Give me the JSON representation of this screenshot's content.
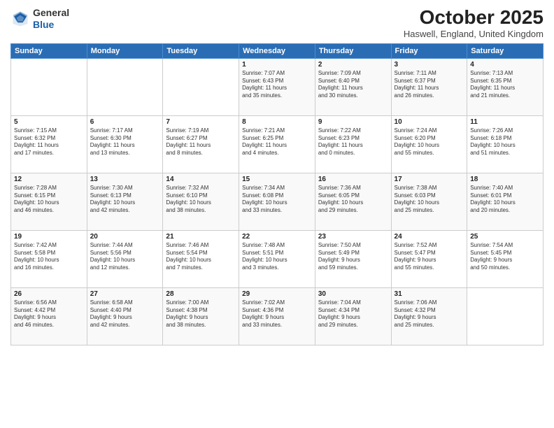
{
  "logo": {
    "general": "General",
    "blue": "Blue"
  },
  "title": "October 2025",
  "location": "Haswell, England, United Kingdom",
  "days_of_week": [
    "Sunday",
    "Monday",
    "Tuesday",
    "Wednesday",
    "Thursday",
    "Friday",
    "Saturday"
  ],
  "weeks": [
    [
      {
        "day": "",
        "info": ""
      },
      {
        "day": "",
        "info": ""
      },
      {
        "day": "",
        "info": ""
      },
      {
        "day": "1",
        "info": "Sunrise: 7:07 AM\nSunset: 6:43 PM\nDaylight: 11 hours\nand 35 minutes."
      },
      {
        "day": "2",
        "info": "Sunrise: 7:09 AM\nSunset: 6:40 PM\nDaylight: 11 hours\nand 30 minutes."
      },
      {
        "day": "3",
        "info": "Sunrise: 7:11 AM\nSunset: 6:37 PM\nDaylight: 11 hours\nand 26 minutes."
      },
      {
        "day": "4",
        "info": "Sunrise: 7:13 AM\nSunset: 6:35 PM\nDaylight: 11 hours\nand 21 minutes."
      }
    ],
    [
      {
        "day": "5",
        "info": "Sunrise: 7:15 AM\nSunset: 6:32 PM\nDaylight: 11 hours\nand 17 minutes."
      },
      {
        "day": "6",
        "info": "Sunrise: 7:17 AM\nSunset: 6:30 PM\nDaylight: 11 hours\nand 13 minutes."
      },
      {
        "day": "7",
        "info": "Sunrise: 7:19 AM\nSunset: 6:27 PM\nDaylight: 11 hours\nand 8 minutes."
      },
      {
        "day": "8",
        "info": "Sunrise: 7:21 AM\nSunset: 6:25 PM\nDaylight: 11 hours\nand 4 minutes."
      },
      {
        "day": "9",
        "info": "Sunrise: 7:22 AM\nSunset: 6:23 PM\nDaylight: 11 hours\nand 0 minutes."
      },
      {
        "day": "10",
        "info": "Sunrise: 7:24 AM\nSunset: 6:20 PM\nDaylight: 10 hours\nand 55 minutes."
      },
      {
        "day": "11",
        "info": "Sunrise: 7:26 AM\nSunset: 6:18 PM\nDaylight: 10 hours\nand 51 minutes."
      }
    ],
    [
      {
        "day": "12",
        "info": "Sunrise: 7:28 AM\nSunset: 6:15 PM\nDaylight: 10 hours\nand 46 minutes."
      },
      {
        "day": "13",
        "info": "Sunrise: 7:30 AM\nSunset: 6:13 PM\nDaylight: 10 hours\nand 42 minutes."
      },
      {
        "day": "14",
        "info": "Sunrise: 7:32 AM\nSunset: 6:10 PM\nDaylight: 10 hours\nand 38 minutes."
      },
      {
        "day": "15",
        "info": "Sunrise: 7:34 AM\nSunset: 6:08 PM\nDaylight: 10 hours\nand 33 minutes."
      },
      {
        "day": "16",
        "info": "Sunrise: 7:36 AM\nSunset: 6:05 PM\nDaylight: 10 hours\nand 29 minutes."
      },
      {
        "day": "17",
        "info": "Sunrise: 7:38 AM\nSunset: 6:03 PM\nDaylight: 10 hours\nand 25 minutes."
      },
      {
        "day": "18",
        "info": "Sunrise: 7:40 AM\nSunset: 6:01 PM\nDaylight: 10 hours\nand 20 minutes."
      }
    ],
    [
      {
        "day": "19",
        "info": "Sunrise: 7:42 AM\nSunset: 5:58 PM\nDaylight: 10 hours\nand 16 minutes."
      },
      {
        "day": "20",
        "info": "Sunrise: 7:44 AM\nSunset: 5:56 PM\nDaylight: 10 hours\nand 12 minutes."
      },
      {
        "day": "21",
        "info": "Sunrise: 7:46 AM\nSunset: 5:54 PM\nDaylight: 10 hours\nand 7 minutes."
      },
      {
        "day": "22",
        "info": "Sunrise: 7:48 AM\nSunset: 5:51 PM\nDaylight: 10 hours\nand 3 minutes."
      },
      {
        "day": "23",
        "info": "Sunrise: 7:50 AM\nSunset: 5:49 PM\nDaylight: 9 hours\nand 59 minutes."
      },
      {
        "day": "24",
        "info": "Sunrise: 7:52 AM\nSunset: 5:47 PM\nDaylight: 9 hours\nand 55 minutes."
      },
      {
        "day": "25",
        "info": "Sunrise: 7:54 AM\nSunset: 5:45 PM\nDaylight: 9 hours\nand 50 minutes."
      }
    ],
    [
      {
        "day": "26",
        "info": "Sunrise: 6:56 AM\nSunset: 4:42 PM\nDaylight: 9 hours\nand 46 minutes."
      },
      {
        "day": "27",
        "info": "Sunrise: 6:58 AM\nSunset: 4:40 PM\nDaylight: 9 hours\nand 42 minutes."
      },
      {
        "day": "28",
        "info": "Sunrise: 7:00 AM\nSunset: 4:38 PM\nDaylight: 9 hours\nand 38 minutes."
      },
      {
        "day": "29",
        "info": "Sunrise: 7:02 AM\nSunset: 4:36 PM\nDaylight: 9 hours\nand 33 minutes."
      },
      {
        "day": "30",
        "info": "Sunrise: 7:04 AM\nSunset: 4:34 PM\nDaylight: 9 hours\nand 29 minutes."
      },
      {
        "day": "31",
        "info": "Sunrise: 7:06 AM\nSunset: 4:32 PM\nDaylight: 9 hours\nand 25 minutes."
      },
      {
        "day": "",
        "info": ""
      }
    ]
  ]
}
